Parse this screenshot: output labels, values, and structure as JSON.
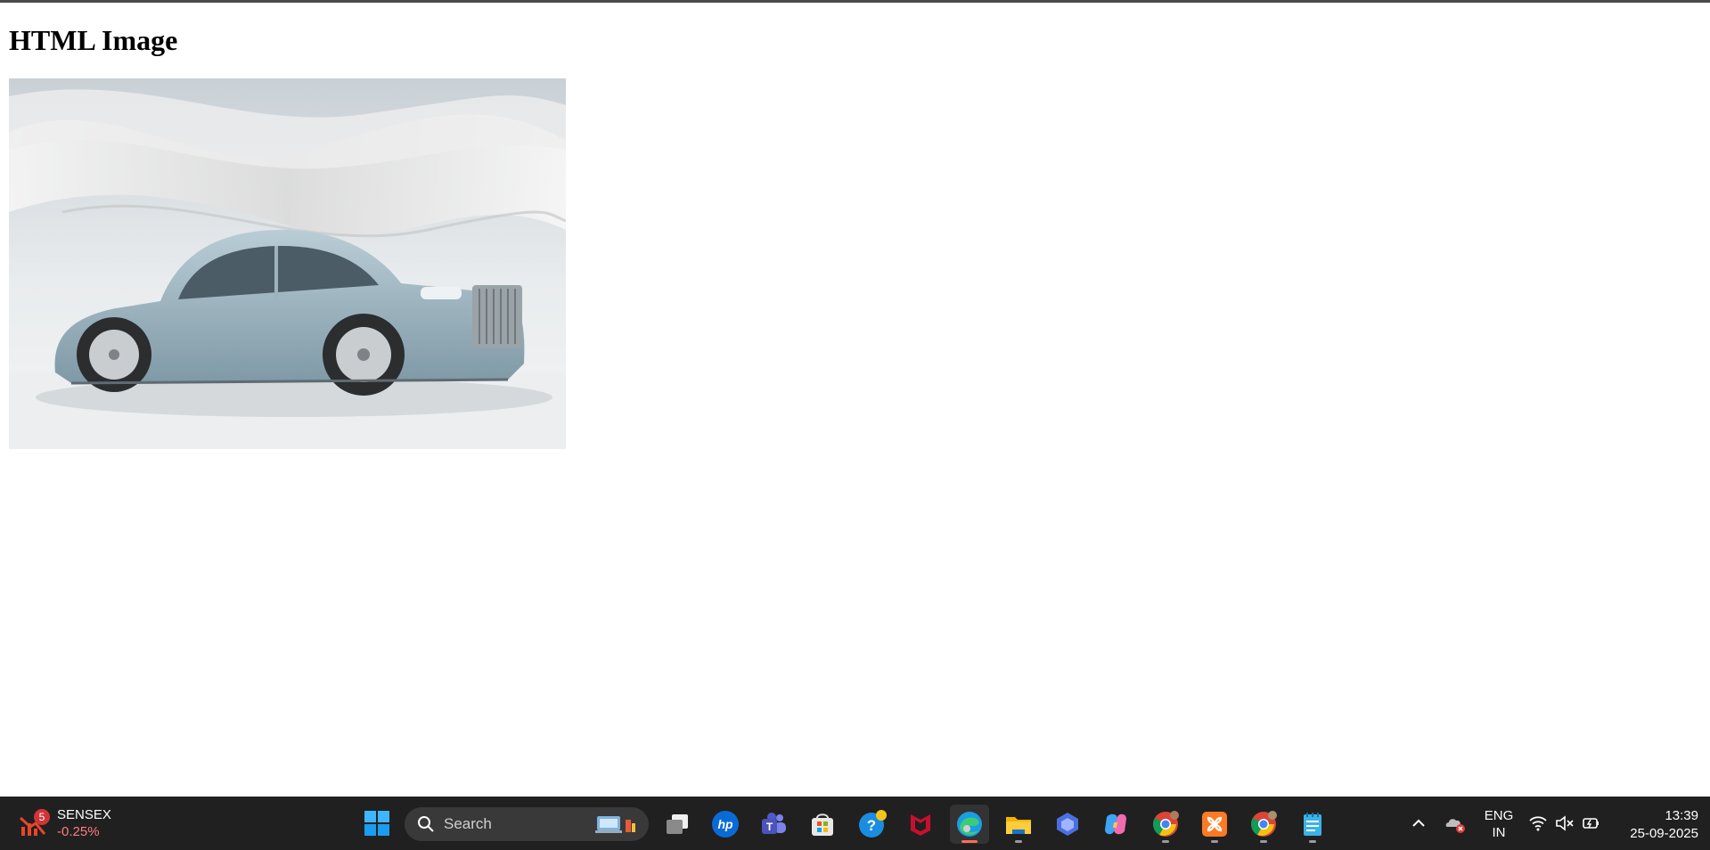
{
  "page": {
    "title": "HTML Image"
  },
  "taskbar": {
    "widget": {
      "name": "SENSEX",
      "change": "-0.25%",
      "badge": "5"
    },
    "search": {
      "label": "Search"
    },
    "apps": [
      {
        "name": "task-view",
        "icon": "task-view-icon"
      },
      {
        "name": "hp",
        "icon": "hp-icon"
      },
      {
        "name": "teams",
        "icon": "teams-icon"
      },
      {
        "name": "microsoft-store",
        "icon": "store-icon"
      },
      {
        "name": "get-help",
        "icon": "help-icon"
      },
      {
        "name": "mcafee",
        "icon": "mcafee-icon"
      },
      {
        "name": "edge",
        "icon": "edge-icon",
        "active": true
      },
      {
        "name": "file-explorer",
        "icon": "folder-icon"
      },
      {
        "name": "copilot-app",
        "icon": "copilot-app-icon"
      },
      {
        "name": "copilot",
        "icon": "copilot-icon"
      },
      {
        "name": "chrome-profile-1",
        "icon": "chrome-icon"
      },
      {
        "name": "xampp",
        "icon": "xampp-icon"
      },
      {
        "name": "chrome-profile-2",
        "icon": "chrome-icon"
      },
      {
        "name": "notepad",
        "icon": "notepad-icon"
      }
    ],
    "tray": {
      "lang_primary": "ENG",
      "lang_secondary": "IN",
      "time": "13:39",
      "date": "25-09-2025"
    }
  },
  "colors": {
    "taskbar_bg": "#202020",
    "accent_active": "#ff6b5a",
    "negative": "#ff7c7c"
  }
}
